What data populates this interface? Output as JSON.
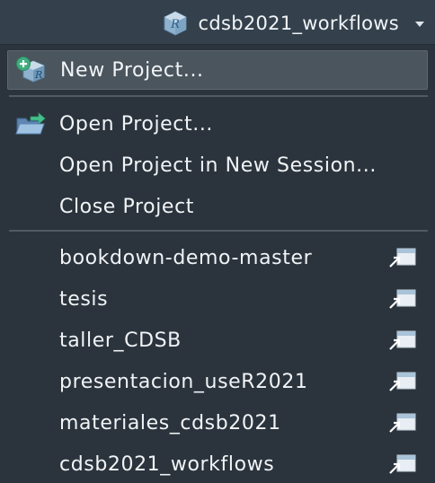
{
  "project_selector": {
    "name": "cdsb2021_workflows",
    "icon": "r-project-cube-icon"
  },
  "menu": {
    "new_project": "New Project...",
    "open_project": "Open Project...",
    "open_project_new_session": "Open Project in New Session...",
    "close_project": "Close Project",
    "recent_projects": [
      "bookdown-demo-master",
      "tesis",
      "taller_CDSB",
      "presentacion_useR2021",
      "materiales_cdsb2021",
      "cdsb2021_workflows"
    ]
  },
  "colors": {
    "background": "#2b343d",
    "topbar": "#34414d",
    "highlight": "#4b555e",
    "separator": "#505a63",
    "accent_green": "#5bc8a0",
    "r_blue": "#3a8cc2"
  },
  "icons": {
    "new_project": "new-project-icon",
    "open_project": "open-folder-icon",
    "open_in_new_window": "open-in-new-window-icon"
  }
}
